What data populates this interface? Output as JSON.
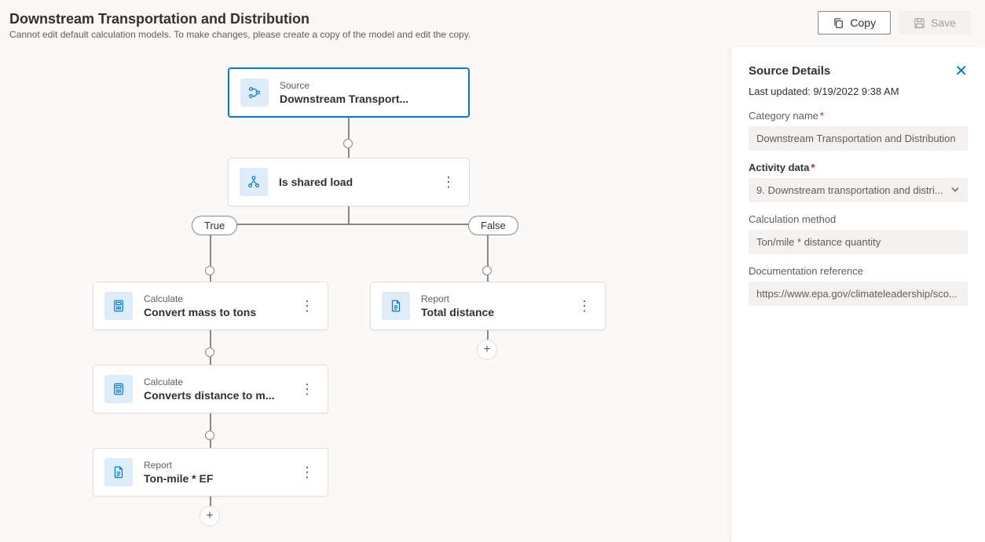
{
  "header": {
    "title": "Downstream Transportation and Distribution",
    "subtitle": "Cannot edit default calculation models. To make changes, please create a copy of the model and edit the copy.",
    "copy": "Copy",
    "save": "Save"
  },
  "nodes": {
    "source": {
      "label": "Source",
      "title": "Downstream Transport..."
    },
    "condition": {
      "title": "Is shared load"
    },
    "calc1": {
      "label": "Calculate",
      "title": "Convert mass to tons"
    },
    "calc2": {
      "label": "Calculate",
      "title": "Converts distance to m..."
    },
    "report1": {
      "label": "Report",
      "title": "Ton-mile * EF"
    },
    "report2": {
      "label": "Report",
      "title": "Total distance"
    }
  },
  "badges": {
    "t": "True",
    "f": "False"
  },
  "panel": {
    "title": "Source Details",
    "updated": "Last updated: 9/19/2022 9:38 AM",
    "cat_label": "Category name",
    "cat_val": "Downstream Transportation and Distribution",
    "act_label": "Activity data",
    "act_val": "9. Downstream transportation and distri...",
    "calc_label": "Calculation method",
    "calc_val": "Ton/mile * distance quantity",
    "doc_label": "Documentation reference",
    "doc_val": "https://www.epa.gov/climateleadership/sco..."
  }
}
